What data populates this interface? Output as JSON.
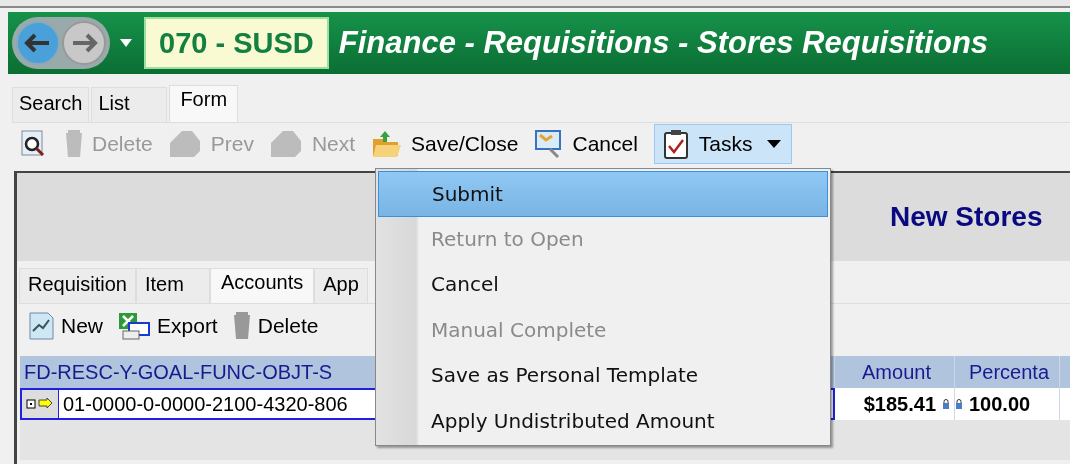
{
  "header": {
    "company": "070 - SUSD",
    "title": "Finance - Requisitions - Stores Requisitions"
  },
  "view_tabs": [
    {
      "label": "Search",
      "selected": false
    },
    {
      "label": "List",
      "selected": false
    },
    {
      "label": "Form",
      "selected": true
    }
  ],
  "toolbar": [
    {
      "kind": "find",
      "disabled": false
    },
    {
      "kind": "delete",
      "label": "Delete",
      "disabled": true
    },
    {
      "kind": "prev",
      "label": "Prev",
      "disabled": true
    },
    {
      "kind": "next",
      "label": "Next",
      "disabled": true
    },
    {
      "kind": "save",
      "label": "Save/Close",
      "disabled": false
    },
    {
      "kind": "cancel",
      "label": "Cancel",
      "disabled": false
    },
    {
      "kind": "tasks",
      "label": "Tasks",
      "disabled": false
    }
  ],
  "form_title": "New Stores",
  "sub_tabs": [
    {
      "label": "Requisition",
      "selected": false
    },
    {
      "label": "Item",
      "selected": false
    },
    {
      "label": "Accounts",
      "selected": true
    },
    {
      "label": "App",
      "selected": false
    }
  ],
  "sub_toolbar": [
    {
      "kind": "new",
      "label": "New"
    },
    {
      "kind": "export",
      "label": "Export"
    },
    {
      "kind": "delete",
      "label": "Delete"
    }
  ],
  "grid": {
    "columns": [
      "FD-RESC-Y-GOAL-FUNC-OBJT-S",
      "Amount",
      "Percenta"
    ],
    "rows": [
      {
        "selected": true,
        "cells": [
          "01-0000-0-0000-2100-4320-806",
          "$185.41",
          "100.00"
        ]
      }
    ]
  },
  "tasks_menu": [
    {
      "label": "Submit",
      "selected": true,
      "disabled": false
    },
    {
      "label": "Return to Open",
      "selected": false,
      "disabled": true
    },
    {
      "label": "Cancel",
      "selected": false,
      "disabled": false
    },
    {
      "label": "Manual Complete",
      "selected": false,
      "disabled": true
    },
    {
      "label": "Save as Personal Template",
      "selected": false,
      "disabled": false
    },
    {
      "label": "Apply Undistributed Amount",
      "selected": false,
      "disabled": false
    }
  ]
}
